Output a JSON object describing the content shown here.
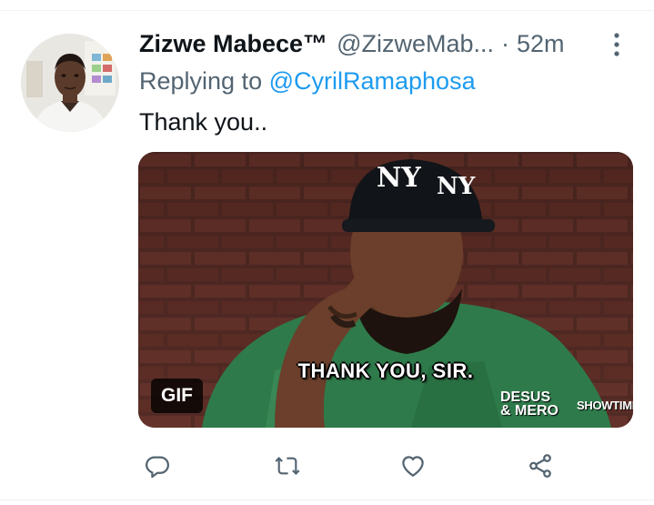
{
  "tweet": {
    "display_name": "Zizwe Mabece™",
    "handle": "@ZizweMab...",
    "separator": "·",
    "time": "52m",
    "reply_prefix": "Replying to",
    "reply_to": "@CyrilRamaphosa",
    "text": "Thank you..",
    "more_icon": "more-vertical-icon"
  },
  "media": {
    "caption": "THANK YOU, SIR.",
    "badge": "GIF",
    "brand_line1": "DESUS",
    "brand_line2": "& MERO",
    "network": "SHOWTIME"
  },
  "actions": [
    {
      "name": "reply",
      "icon": "reply-icon"
    },
    {
      "name": "retweet",
      "icon": "retweet-icon"
    },
    {
      "name": "like",
      "icon": "heart-icon"
    },
    {
      "name": "share",
      "icon": "share-icon"
    }
  ],
  "colors": {
    "text_primary": "#0f1419",
    "text_secondary": "#536471",
    "accent": "#1d9bf0",
    "divider": "#eff3f4"
  }
}
